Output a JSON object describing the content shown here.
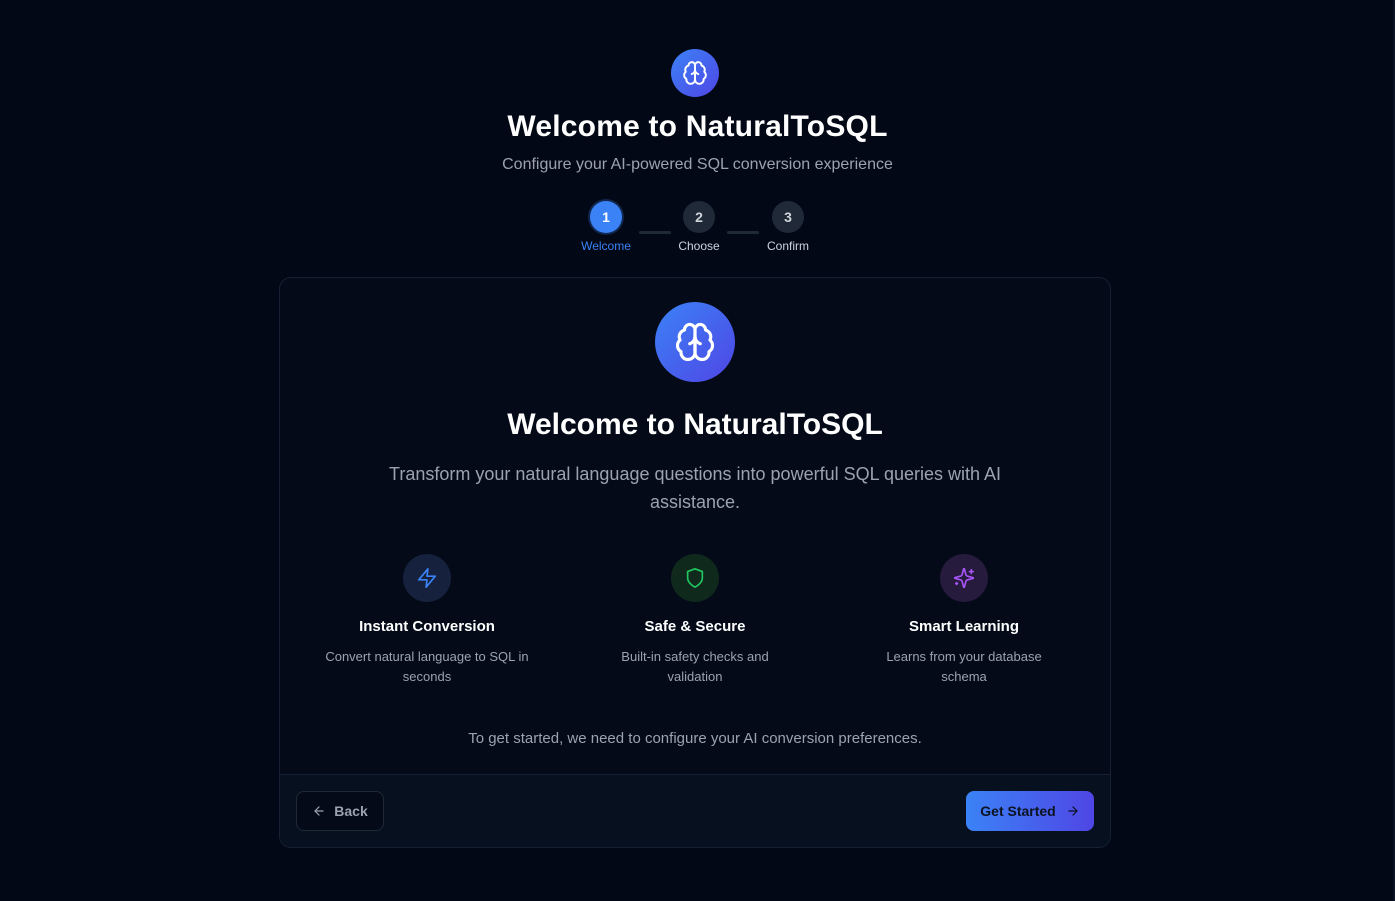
{
  "header": {
    "logo_icon": "brain-icon",
    "title": "Welcome to NaturalToSQL",
    "subtitle": "Configure your AI-powered SQL conversion experience"
  },
  "stepper": {
    "steps": [
      {
        "number": "1",
        "label": "Welcome",
        "active": true
      },
      {
        "number": "2",
        "label": "Choose",
        "active": false
      },
      {
        "number": "3",
        "label": "Confirm",
        "active": false
      }
    ]
  },
  "card": {
    "logo_icon": "brain-icon",
    "title": "Welcome to NaturalToSQL",
    "description": "Transform your natural language questions into powerful SQL queries with AI assistance.",
    "features": [
      {
        "icon": "lightning-icon",
        "title": "Instant Conversion",
        "description": "Convert natural language to SQL in seconds",
        "color": "#3b82f6",
        "bg": "#15213d"
      },
      {
        "icon": "shield-icon",
        "title": "Safe & Secure",
        "description": "Built-in safety checks and validation",
        "color": "#22c55e",
        "bg": "#0f2a1d"
      },
      {
        "icon": "sparkles-icon",
        "title": "Smart Learning",
        "description": "Learns from your database schema",
        "color": "#a855f7",
        "bg": "#261a3d"
      }
    ],
    "note": "To get started, we need to configure your AI conversion preferences."
  },
  "footer": {
    "back_label": "Back",
    "start_label": "Get Started"
  },
  "colors": {
    "background": "#030816",
    "accent": "#3b82f6",
    "accent_end": "#4f46e5"
  }
}
